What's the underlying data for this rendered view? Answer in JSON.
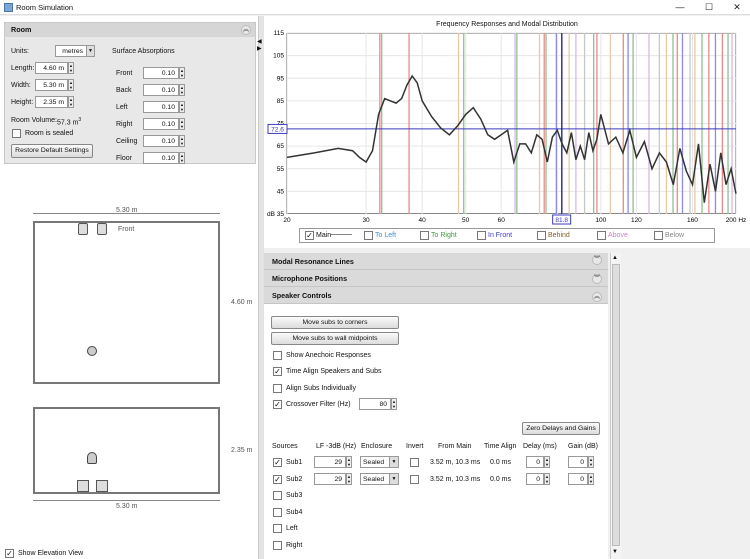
{
  "window": {
    "title": "Room Simulation",
    "minimize": "—",
    "maximize": "☐",
    "close": "✕"
  },
  "room": {
    "title": "Room",
    "units_label": "Units:",
    "units_value": "metres",
    "length_label": "Length:",
    "length_value": "4.60 m",
    "width_label": "Width:",
    "width_value": "5.30 m",
    "height_label": "Height:",
    "height_value": "2.35 m",
    "volume_label": "Room Volume:",
    "volume_value": "57.3 m",
    "volume_unit_sup": "3",
    "sealed_label": "Room is sealed",
    "restore_label": "Restore Default Settings",
    "absorptions_title": "Surface Absorptions",
    "absorptions": [
      {
        "label": "Front",
        "value": "0.10"
      },
      {
        "label": "Back",
        "value": "0.10"
      },
      {
        "label": "Left",
        "value": "0.10"
      },
      {
        "label": "Right",
        "value": "0.10"
      },
      {
        "label": "Ceiling",
        "value": "0.10"
      },
      {
        "label": "Floor",
        "value": "0.10"
      }
    ]
  },
  "plan": {
    "width_label": "5.30 m",
    "depth_label": "4.60 m",
    "front_label": "Front",
    "elev_height_label": "2.35 m",
    "elev_width_label": "5.30 m",
    "elevation_view_label": "Show Elevation View",
    "elevation_view_checked": true
  },
  "chart_data": {
    "type": "line",
    "title": "Frequency Responses and Modal Distribution",
    "xscale": "log",
    "xlim": [
      20,
      200
    ],
    "ylim": [
      35,
      115
    ],
    "ylabel": "dB",
    "xticks": [
      20,
      30,
      40,
      50,
      60,
      80,
      100,
      120,
      160,
      200
    ],
    "xtick_labels": [
      "20",
      "30",
      "40",
      "50",
      "60",
      "80",
      "100",
      "120",
      "160",
      "200 Hz"
    ],
    "yticks": [
      45,
      55,
      65,
      75,
      85,
      95,
      105,
      115
    ],
    "ytick_labels": [
      "45",
      "55",
      "65",
      "75",
      "85",
      "95",
      "105",
      "115"
    ],
    "y_bottom_label": "dB 35",
    "cursor_x": 81.8,
    "cursor_x_label": "81.8",
    "cursor_y": 72.6,
    "cursor_y_label": "72.6",
    "series": [
      {
        "name": "Main",
        "color": "#333333",
        "x": [
          20,
          23,
          26,
          28,
          29,
          30,
          31,
          32,
          33,
          34,
          35,
          36,
          37,
          38,
          39,
          40,
          42,
          44,
          46,
          48,
          50,
          52,
          54,
          56,
          58,
          60,
          62,
          64,
          66,
          68,
          70,
          72,
          74,
          76,
          78,
          80,
          82,
          84,
          86,
          88,
          90,
          92,
          94,
          96,
          98,
          100,
          104,
          108,
          112,
          116,
          120,
          125,
          130,
          135,
          140,
          145,
          150,
          155,
          160,
          165,
          170,
          175,
          180,
          185,
          190,
          195,
          200
        ],
        "y": [
          60,
          62,
          64,
          63,
          60,
          58,
          63,
          79,
          86,
          85,
          84,
          86,
          92,
          96,
          93,
          85,
          78,
          73,
          70,
          74,
          79,
          82,
          77,
          70,
          68,
          70,
          72,
          58,
          66,
          66,
          62,
          70,
          68,
          58,
          69,
          72,
          66,
          62,
          71,
          59,
          65,
          59,
          71,
          63,
          68,
          79,
          66,
          69,
          62,
          72,
          60,
          67,
          55,
          62,
          58,
          48,
          64,
          54,
          48,
          66,
          40,
          57,
          45,
          62,
          48,
          55,
          44
        ]
      }
    ],
    "modes": [
      {
        "x": 32.2,
        "color": "#e88a8a"
      },
      {
        "x": 37.4,
        "color": "#e88a8a"
      },
      {
        "x": 32.5,
        "color": "#8fc08f"
      },
      {
        "x": 48.2,
        "color": "#e8c8a8"
      },
      {
        "x": 49.5,
        "color": "#8fc08f"
      },
      {
        "x": 64.4,
        "color": "#d8b8e8"
      },
      {
        "x": 65.0,
        "color": "#8fc08f"
      },
      {
        "x": 73.0,
        "color": "#e8c8a8"
      },
      {
        "x": 74.8,
        "color": "#e88a8a"
      },
      {
        "x": 75.5,
        "color": "#8fc08f"
      },
      {
        "x": 79.6,
        "color": "#8b8bdf"
      },
      {
        "x": 82.0,
        "color": "#8b8bdf"
      },
      {
        "x": 85.0,
        "color": "#e8c8a8"
      },
      {
        "x": 88.0,
        "color": "#d8b8e8"
      },
      {
        "x": 92.0,
        "color": "#c8c8c8"
      },
      {
        "x": 96.4,
        "color": "#8fc08f"
      },
      {
        "x": 98.0,
        "color": "#e88a8a"
      },
      {
        "x": 105.0,
        "color": "#e8c8a8"
      },
      {
        "x": 112.2,
        "color": "#e88a8a"
      },
      {
        "x": 115.0,
        "color": "#8b8bdf"
      },
      {
        "x": 118.0,
        "color": "#8fc08f"
      },
      {
        "x": 128.0,
        "color": "#d8b8e8"
      },
      {
        "x": 135.0,
        "color": "#c8c8c8"
      },
      {
        "x": 140.0,
        "color": "#e8c8a8"
      },
      {
        "x": 144.8,
        "color": "#8fc08f"
      },
      {
        "x": 148.0,
        "color": "#e88a8a"
      },
      {
        "x": 152.0,
        "color": "#8b8bdf"
      },
      {
        "x": 158.0,
        "color": "#c8c8c8"
      },
      {
        "x": 162.0,
        "color": "#e8c8a8"
      },
      {
        "x": 168.0,
        "color": "#8fc08f"
      },
      {
        "x": 174.0,
        "color": "#e88a8a"
      },
      {
        "x": 180.0,
        "color": "#8b8bdf"
      },
      {
        "x": 186.5,
        "color": "#e88a8a"
      },
      {
        "x": 192.0,
        "color": "#8fc08f"
      },
      {
        "x": 196.0,
        "color": "#d8b8e8"
      }
    ],
    "legend": [
      {
        "label": "Main",
        "checked": true,
        "color": "#111111"
      },
      {
        "label": "To Left",
        "checked": false,
        "color": "#3a8fd6"
      },
      {
        "label": "To Right",
        "checked": false,
        "color": "#3a9a3a"
      },
      {
        "label": "In Front",
        "checked": false,
        "color": "#3a3ad0"
      },
      {
        "label": "Behind",
        "checked": false,
        "color": "#8a5a2a"
      },
      {
        "label": "Above",
        "checked": false,
        "color": "#d080d0"
      },
      {
        "label": "Below",
        "checked": false,
        "color": "#888888"
      }
    ],
    "main_legend_line": "———"
  },
  "sections": {
    "modal": "Modal Resonance Lines",
    "mic": "Microphone Positions",
    "speaker": "Speaker Controls"
  },
  "speaker": {
    "move_corners": "Move subs to corners",
    "move_midpoints": "Move subs to wall midpoints",
    "anechoic_label": "Show Anechoic Responses",
    "anechoic_checked": false,
    "timealign_label": "Time Align Speakers and Subs",
    "timealign_checked": true,
    "alignsubs_label": "Align Subs Individually",
    "alignsubs_checked": false,
    "crossover_label": "Crossover Filter (Hz)",
    "crossover_checked": true,
    "crossover_value": "80",
    "zero_label": "Zero Delays and Gains",
    "headers": {
      "sources": "Sources",
      "lf": "LF -3dB (Hz)",
      "enclosure": "Enclosure",
      "invert": "Invert",
      "from_main": "From Main",
      "time_align": "Time Align",
      "delay": "Delay (ms)",
      "gain": "Gain (dB)"
    },
    "sources": [
      {
        "name": "Sub1",
        "checked": true,
        "lf": "29",
        "enclosure": "Sealed",
        "from_main": "3.52 m, 10.3 ms",
        "time_align": "0.0 ms",
        "delay": "0",
        "gain": "0"
      },
      {
        "name": "Sub2",
        "checked": true,
        "lf": "29",
        "enclosure": "Sealed",
        "from_main": "3.52 m, 10.3 ms",
        "time_align": "0.0 ms",
        "delay": "0",
        "gain": "0"
      },
      {
        "name": "Sub3",
        "checked": false
      },
      {
        "name": "Sub4",
        "checked": false
      },
      {
        "name": "Left",
        "checked": false
      },
      {
        "name": "Right",
        "checked": false
      }
    ]
  }
}
